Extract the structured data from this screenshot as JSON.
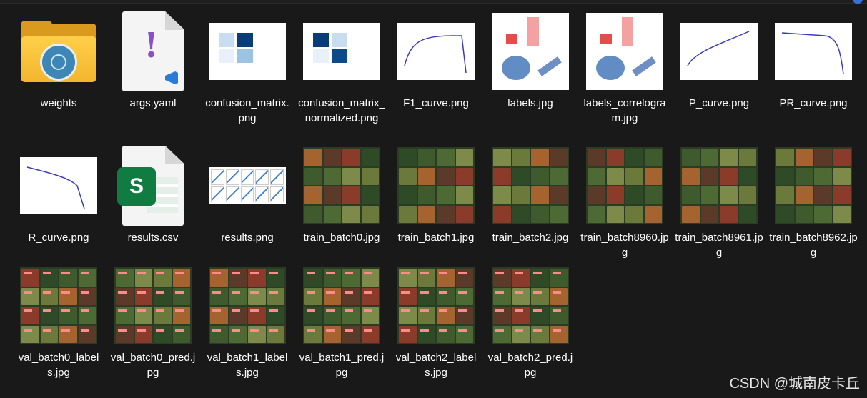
{
  "files": [
    {
      "name": "weights",
      "kind": "folder",
      "icon": "folder-icon"
    },
    {
      "name": "args.yaml",
      "kind": "yaml",
      "icon": "yaml-file-icon"
    },
    {
      "name": "confusion_matrix.png",
      "kind": "image",
      "icon": "image-thumbnail"
    },
    {
      "name": "confusion_matrix_normalized.png",
      "kind": "image",
      "icon": "image-thumbnail"
    },
    {
      "name": "F1_curve.png",
      "kind": "image",
      "icon": "image-thumbnail"
    },
    {
      "name": "labels.jpg",
      "kind": "image",
      "icon": "image-thumbnail"
    },
    {
      "name": "labels_correlogram.jpg",
      "kind": "image",
      "icon": "image-thumbnail"
    },
    {
      "name": "P_curve.png",
      "kind": "image",
      "icon": "image-thumbnail"
    },
    {
      "name": "PR_curve.png",
      "kind": "image",
      "icon": "image-thumbnail"
    },
    {
      "name": "R_curve.png",
      "kind": "image",
      "icon": "image-thumbnail"
    },
    {
      "name": "results.csv",
      "kind": "csv",
      "icon": "excel-csv-icon"
    },
    {
      "name": "results.png",
      "kind": "image",
      "icon": "image-thumbnail"
    },
    {
      "name": "train_batch0.jpg",
      "kind": "image",
      "icon": "image-thumbnail"
    },
    {
      "name": "train_batch1.jpg",
      "kind": "image",
      "icon": "image-thumbnail"
    },
    {
      "name": "train_batch2.jpg",
      "kind": "image",
      "icon": "image-thumbnail"
    },
    {
      "name": "train_batch8960.jpg",
      "kind": "image",
      "icon": "image-thumbnail"
    },
    {
      "name": "train_batch8961.jpg",
      "kind": "image",
      "icon": "image-thumbnail"
    },
    {
      "name": "train_batch8962.jpg",
      "kind": "image",
      "icon": "image-thumbnail"
    },
    {
      "name": "val_batch0_labels.jpg",
      "kind": "image",
      "icon": "image-thumbnail"
    },
    {
      "name": "val_batch0_pred.jpg",
      "kind": "image",
      "icon": "image-thumbnail"
    },
    {
      "name": "val_batch1_labels.jpg",
      "kind": "image",
      "icon": "image-thumbnail"
    },
    {
      "name": "val_batch1_pred.jpg",
      "kind": "image",
      "icon": "image-thumbnail"
    },
    {
      "name": "val_batch2_labels.jpg",
      "kind": "image",
      "icon": "image-thumbnail"
    },
    {
      "name": "val_batch2_pred.jpg",
      "kind": "image",
      "icon": "image-thumbnail"
    }
  ],
  "watermark": "CSDN @城南皮卡丘",
  "colors": {
    "background": "#191919",
    "accent": "#3a6fd8",
    "folder": "#f3b52d"
  }
}
